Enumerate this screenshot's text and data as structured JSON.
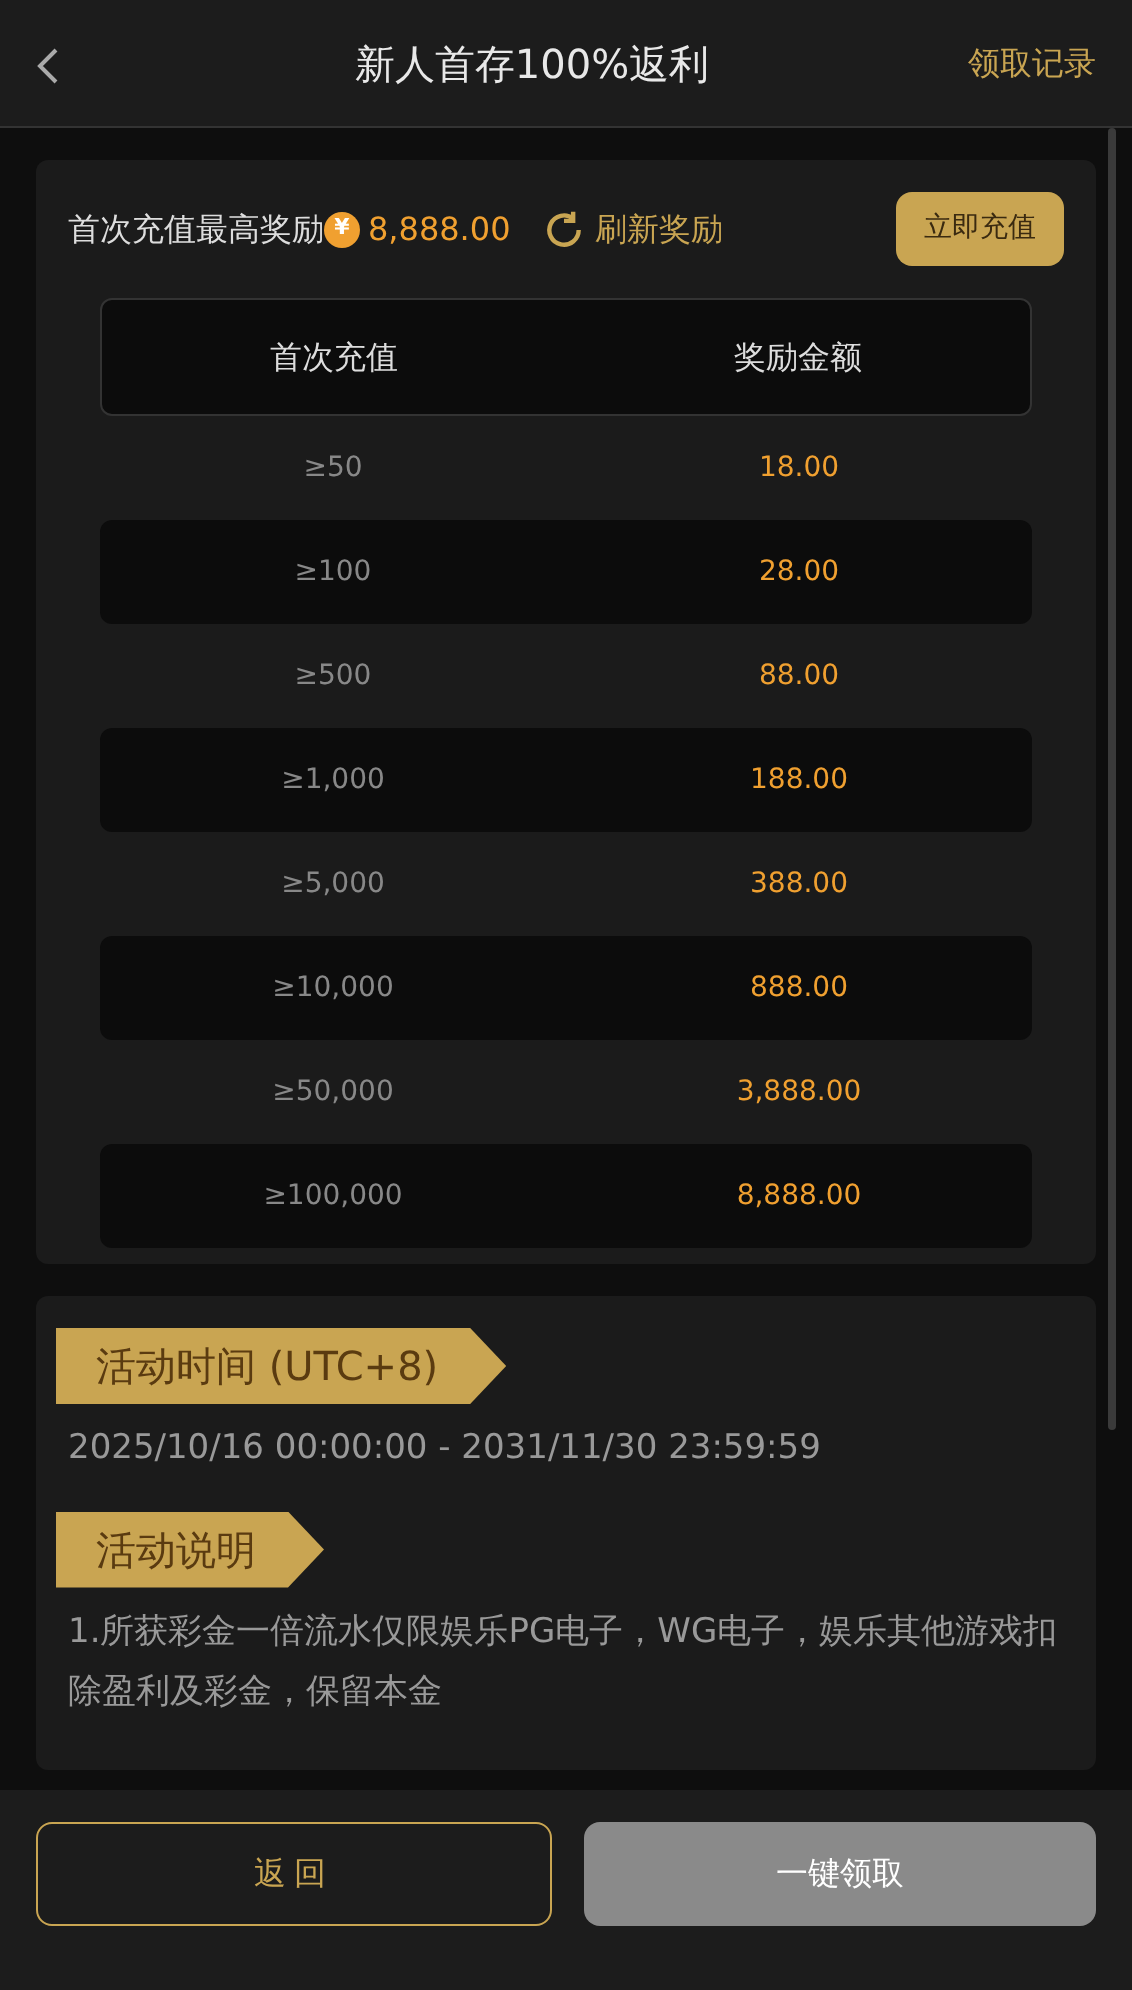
{
  "header": {
    "title": "新人首存100%返利",
    "records_link": "领取记录"
  },
  "reward_card": {
    "label": "首次充值最高奖励",
    "currency": "¥",
    "max_amount": "8,888.00",
    "refresh": "刷新奖励",
    "deposit_button": "立即充值",
    "table": {
      "columns": [
        "首次充值",
        "奖励金额"
      ],
      "rows": [
        {
          "deposit": "≥50",
          "reward": "18.00"
        },
        {
          "deposit": "≥100",
          "reward": "28.00"
        },
        {
          "deposit": "≥500",
          "reward": "88.00"
        },
        {
          "deposit": "≥1,000",
          "reward": "188.00"
        },
        {
          "deposit": "≥5,000",
          "reward": "388.00"
        },
        {
          "deposit": "≥10,000",
          "reward": "888.00"
        },
        {
          "deposit": "≥50,000",
          "reward": "3,888.00"
        },
        {
          "deposit": "≥100,000",
          "reward": "8,888.00"
        }
      ]
    }
  },
  "info_card": {
    "sections": [
      {
        "heading": "活动时间 (UTC+8)",
        "body": "2025/10/16 00:00:00 - 2031/11/30 23:59:59"
      },
      {
        "heading": "活动说明",
        "body": "1.所获彩金一倍流水仅限娱乐PG电子，WG电子，娱乐其他游戏扣除盈利及彩金，保留本金"
      }
    ]
  },
  "footer": {
    "back_button": "返回",
    "claim_button": {
      "label": "一键领取",
      "disabled": true
    }
  }
}
